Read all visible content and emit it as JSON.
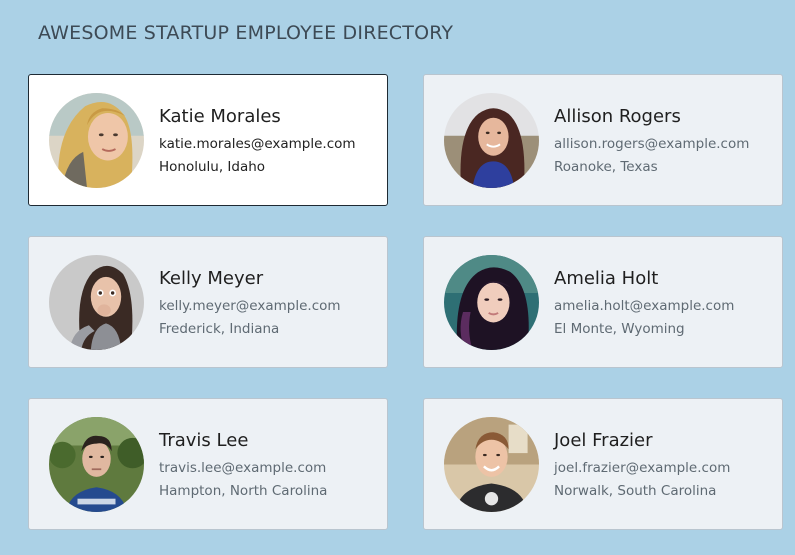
{
  "page": {
    "title": "AWESOME STARTUP EMPLOYEE DIRECTORY"
  },
  "employees": [
    {
      "name": "Katie Morales",
      "email": "katie.morales@example.com",
      "location": "Honolulu, Idaho",
      "selected": true,
      "avatar": "avatar-photo-katie-morales"
    },
    {
      "name": "Allison Rogers",
      "email": "allison.rogers@example.com",
      "location": "Roanoke, Texas",
      "selected": false,
      "avatar": "avatar-photo-allison-rogers"
    },
    {
      "name": "Kelly Meyer",
      "email": "kelly.meyer@example.com",
      "location": "Frederick, Indiana",
      "selected": false,
      "avatar": "avatar-photo-kelly-meyer"
    },
    {
      "name": "Amelia Holt",
      "email": "amelia.holt@example.com",
      "location": "El Monte, Wyoming",
      "selected": false,
      "avatar": "avatar-photo-amelia-holt"
    },
    {
      "name": "Travis Lee",
      "email": "travis.lee@example.com",
      "location": "Hampton, North Carolina",
      "selected": false,
      "avatar": "avatar-photo-travis-lee"
    },
    {
      "name": "Joel Frazier",
      "email": "joel.frazier@example.com",
      "location": "Norwalk, South Carolina",
      "selected": false,
      "avatar": "avatar-photo-joel-frazier"
    }
  ],
  "colors": {
    "page_background": "#abd1e6",
    "card_background": "#edf1f5",
    "selected_card_background": "#ffffff",
    "selected_card_border": "#1e2a33",
    "title_text": "#3d4a55",
    "name_text": "#1f1f1f",
    "secondary_text": "#5f6a73"
  }
}
